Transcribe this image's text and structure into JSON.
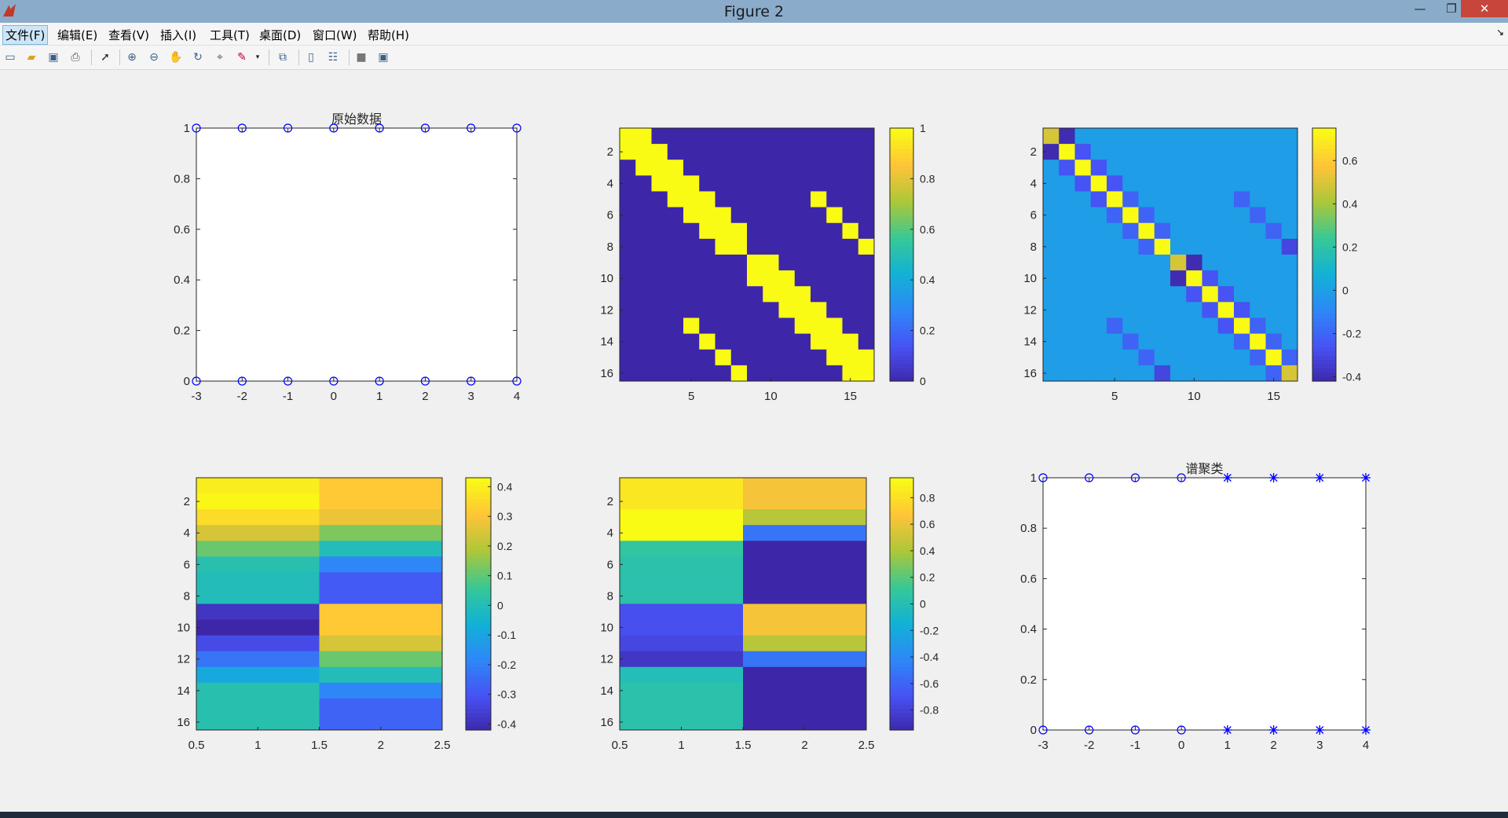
{
  "window": {
    "title": "Figure 2",
    "minimize": "—",
    "maximize": "❐",
    "close": "✕"
  },
  "menu": [
    {
      "label": "文件(F)",
      "active": true
    },
    {
      "label": "编辑(E)"
    },
    {
      "label": "查看(V)"
    },
    {
      "label": "插入(I)"
    },
    {
      "label": "工具(T)"
    },
    {
      "label": "桌面(D)"
    },
    {
      "label": "窗口(W)"
    },
    {
      "label": "帮助(H)"
    }
  ],
  "menu_arrow": "↘",
  "toolbar": [
    "new-figure-icon",
    "open-icon",
    "save-icon",
    "print-icon",
    "select-arrow-icon",
    "zoom-in-icon",
    "zoom-out-icon",
    "pan-hand-icon",
    "rotate-3d-icon",
    "data-cursor-icon",
    "brush-icon",
    "link-plot-icon",
    "colorbar-icon",
    "legend-icon",
    "hide-plot-tools-icon",
    "show-plot-tools-icon"
  ],
  "chart_data": [
    {
      "type": "scatter",
      "title": "原始数据",
      "xlim": [
        -3,
        4
      ],
      "ylim": [
        0,
        1
      ],
      "xticks": [
        "-3",
        "-2",
        "-1",
        "0",
        "1",
        "2",
        "3",
        "4"
      ],
      "yticks": [
        "0",
        "0.2",
        "0.4",
        "0.6",
        "0.8",
        "1"
      ],
      "series": [
        {
          "marker": "o",
          "color": "#0000ff",
          "x": [
            -3,
            -2,
            -1,
            0,
            1,
            2,
            3,
            4,
            -3,
            -2,
            -1,
            0,
            1,
            2,
            3,
            4
          ],
          "y": [
            1,
            1,
            1,
            1,
            1,
            1,
            1,
            1,
            0,
            0,
            0,
            0,
            0,
            0,
            0,
            0
          ]
        }
      ]
    },
    {
      "type": "heatmap",
      "rows": 16,
      "cols": 16,
      "xticks": [
        "5",
        "10",
        "15"
      ],
      "yticks": [
        "2",
        "4",
        "6",
        "8",
        "10",
        "12",
        "14",
        "16"
      ],
      "colorbar_ticks": [
        "0",
        "0.2",
        "0.4",
        "0.6",
        "0.8",
        "1"
      ],
      "clim": [
        0,
        1
      ],
      "pattern": "adjacency",
      "values": [
        [
          1,
          1,
          0,
          0,
          0,
          0,
          0,
          0,
          0,
          0,
          0,
          0,
          0,
          0,
          0,
          0
        ],
        [
          1,
          1,
          1,
          0,
          0,
          0,
          0,
          0,
          0,
          0,
          0,
          0,
          0,
          0,
          0,
          0
        ],
        [
          0,
          1,
          1,
          1,
          0,
          0,
          0,
          0,
          0,
          0,
          0,
          0,
          0,
          0,
          0,
          0
        ],
        [
          0,
          0,
          1,
          1,
          1,
          0,
          0,
          0,
          0,
          0,
          0,
          0,
          0,
          0,
          0,
          0
        ],
        [
          0,
          0,
          0,
          1,
          1,
          1,
          0,
          0,
          0,
          0,
          0,
          0,
          1,
          0,
          0,
          0
        ],
        [
          0,
          0,
          0,
          0,
          1,
          1,
          1,
          0,
          0,
          0,
          0,
          0,
          0,
          1,
          0,
          0
        ],
        [
          0,
          0,
          0,
          0,
          0,
          1,
          1,
          1,
          0,
          0,
          0,
          0,
          0,
          0,
          1,
          0
        ],
        [
          0,
          0,
          0,
          0,
          0,
          0,
          1,
          1,
          0,
          0,
          0,
          0,
          0,
          0,
          0,
          1
        ],
        [
          0,
          0,
          0,
          0,
          0,
          0,
          0,
          0,
          1,
          1,
          0,
          0,
          0,
          0,
          0,
          0
        ],
        [
          0,
          0,
          0,
          0,
          0,
          0,
          0,
          0,
          1,
          1,
          1,
          0,
          0,
          0,
          0,
          0
        ],
        [
          0,
          0,
          0,
          0,
          0,
          0,
          0,
          0,
          0,
          1,
          1,
          1,
          0,
          0,
          0,
          0
        ],
        [
          0,
          0,
          0,
          0,
          0,
          0,
          0,
          0,
          0,
          0,
          1,
          1,
          1,
          0,
          0,
          0
        ],
        [
          0,
          0,
          0,
          0,
          1,
          0,
          0,
          0,
          0,
          0,
          0,
          1,
          1,
          1,
          0,
          0
        ],
        [
          0,
          0,
          0,
          0,
          0,
          1,
          0,
          0,
          0,
          0,
          0,
          0,
          1,
          1,
          1,
          0
        ],
        [
          0,
          0,
          0,
          0,
          0,
          0,
          1,
          0,
          0,
          0,
          0,
          0,
          0,
          1,
          1,
          1
        ],
        [
          0,
          0,
          0,
          0,
          0,
          0,
          0,
          1,
          0,
          0,
          0,
          0,
          0,
          0,
          1,
          1
        ]
      ]
    },
    {
      "type": "heatmap",
      "rows": 16,
      "cols": 16,
      "xticks": [
        "5",
        "10",
        "15"
      ],
      "yticks": [
        "2",
        "4",
        "6",
        "8",
        "10",
        "12",
        "14",
        "16"
      ],
      "colorbar_ticks": [
        "-0.4",
        "-0.2",
        "0",
        "0.2",
        "0.4",
        "0.6"
      ],
      "clim": [
        -0.42,
        0.75
      ],
      "values": [
        [
          0.5,
          -0.4,
          0,
          0,
          0,
          0,
          0,
          0,
          0,
          0,
          0,
          0,
          0,
          0,
          0,
          0
        ],
        [
          -0.4,
          0.75,
          -0.25,
          0,
          0,
          0,
          0,
          0,
          0,
          0,
          0,
          0,
          0,
          0,
          0,
          0
        ],
        [
          0,
          -0.25,
          0.75,
          -0.25,
          0,
          0,
          0,
          0,
          0,
          0,
          0,
          0,
          0,
          0,
          0,
          0
        ],
        [
          0,
          0,
          -0.25,
          0.75,
          -0.25,
          0,
          0,
          0,
          0,
          0,
          0,
          0,
          0,
          0,
          0,
          0
        ],
        [
          0,
          0,
          0,
          -0.25,
          0.75,
          -0.2,
          0,
          0,
          0,
          0,
          0,
          0,
          -0.2,
          0,
          0,
          0
        ],
        [
          0,
          0,
          0,
          0,
          -0.2,
          0.75,
          -0.2,
          0,
          0,
          0,
          0,
          0,
          0,
          -0.2,
          0,
          0
        ],
        [
          0,
          0,
          0,
          0,
          0,
          -0.2,
          0.75,
          -0.2,
          0,
          0,
          0,
          0,
          0,
          0,
          -0.2,
          0
        ],
        [
          0,
          0,
          0,
          0,
          0,
          0,
          -0.2,
          0.75,
          0,
          0,
          0,
          0,
          0,
          0,
          0,
          -0.3
        ],
        [
          0,
          0,
          0,
          0,
          0,
          0,
          0,
          0,
          0.5,
          -0.4,
          0,
          0,
          0,
          0,
          0,
          0
        ],
        [
          0,
          0,
          0,
          0,
          0,
          0,
          0,
          0,
          -0.4,
          0.75,
          -0.25,
          0,
          0,
          0,
          0,
          0
        ],
        [
          0,
          0,
          0,
          0,
          0,
          0,
          0,
          0,
          0,
          -0.25,
          0.75,
          -0.25,
          0,
          0,
          0,
          0
        ],
        [
          0,
          0,
          0,
          0,
          0,
          0,
          0,
          0,
          0,
          0,
          -0.25,
          0.75,
          -0.25,
          0,
          0,
          0
        ],
        [
          0,
          0,
          0,
          0,
          -0.2,
          0,
          0,
          0,
          0,
          0,
          0,
          -0.25,
          0.75,
          -0.2,
          0,
          0
        ],
        [
          0,
          0,
          0,
          0,
          0,
          -0.2,
          0,
          0,
          0,
          0,
          0,
          0,
          -0.2,
          0.75,
          -0.2,
          0
        ],
        [
          0,
          0,
          0,
          0,
          0,
          0,
          -0.2,
          0,
          0,
          0,
          0,
          0,
          0,
          -0.2,
          0.75,
          -0.2
        ],
        [
          0,
          0,
          0,
          0,
          0,
          0,
          0,
          -0.3,
          0,
          0,
          0,
          0,
          0,
          0,
          -0.2,
          0.5
        ]
      ]
    },
    {
      "type": "heatmap",
      "rows": 16,
      "cols": 2,
      "xticks": [
        "0.5",
        "1",
        "1.5",
        "2",
        "2.5"
      ],
      "yticks": [
        "2",
        "4",
        "6",
        "8",
        "10",
        "12",
        "14",
        "16"
      ],
      "colorbar_ticks": [
        "-0.4",
        "-0.3",
        "-0.2",
        "-0.1",
        "0",
        "0.1",
        "0.2",
        "0.3",
        "0.4"
      ],
      "clim": [
        -0.42,
        0.43
      ],
      "values": [
        [
          0.4,
          0.32
        ],
        [
          0.42,
          0.32
        ],
        [
          0.36,
          0.28
        ],
        [
          0.25,
          0.14
        ],
        [
          0.12,
          0.0
        ],
        [
          0.02,
          -0.18
        ],
        [
          0.0,
          -0.28
        ],
        [
          0.0,
          -0.28
        ],
        [
          -0.38,
          0.32
        ],
        [
          -0.42,
          0.32
        ],
        [
          -0.32,
          0.25
        ],
        [
          -0.22,
          0.12
        ],
        [
          -0.08,
          0.0
        ],
        [
          0.02,
          -0.18
        ],
        [
          0.02,
          -0.26
        ],
        [
          0.02,
          -0.26
        ]
      ]
    },
    {
      "type": "heatmap",
      "rows": 16,
      "cols": 2,
      "xticks": [
        "0.5",
        "1",
        "1.5",
        "2",
        "2.5"
      ],
      "yticks": [
        "2",
        "4",
        "6",
        "8",
        "10",
        "12",
        "14",
        "16"
      ],
      "colorbar_ticks": [
        "-0.8",
        "-0.6",
        "-0.4",
        "-0.2",
        "0",
        "0.2",
        "0.4",
        "0.6",
        "0.8"
      ],
      "clim": [
        -0.95,
        0.95
      ],
      "values": [
        [
          0.85,
          0.65
        ],
        [
          0.85,
          0.65
        ],
        [
          0.95,
          0.45
        ],
        [
          0.95,
          -0.5
        ],
        [
          0.1,
          -0.95
        ],
        [
          0.05,
          -0.95
        ],
        [
          0.05,
          -0.95
        ],
        [
          0.05,
          -0.95
        ],
        [
          -0.7,
          0.65
        ],
        [
          -0.7,
          0.65
        ],
        [
          -0.75,
          0.45
        ],
        [
          -0.85,
          -0.5
        ],
        [
          0.0,
          -0.95
        ],
        [
          0.05,
          -0.95
        ],
        [
          0.05,
          -0.95
        ],
        [
          0.05,
          -0.95
        ]
      ]
    },
    {
      "type": "scatter",
      "title": "谱聚类",
      "xlim": [
        -3,
        4
      ],
      "ylim": [
        0,
        1
      ],
      "xticks": [
        "-3",
        "-2",
        "-1",
        "0",
        "1",
        "2",
        "3",
        "4"
      ],
      "yticks": [
        "0",
        "0.2",
        "0.4",
        "0.6",
        "0.8",
        "1"
      ],
      "series": [
        {
          "marker": "o",
          "color": "#0000ff",
          "x": [
            -3,
            -2,
            -1,
            0,
            -3,
            -2,
            -1,
            0
          ],
          "y": [
            1,
            1,
            1,
            1,
            0,
            0,
            0,
            0
          ]
        },
        {
          "marker": "*",
          "color": "#0000ff",
          "x": [
            1,
            2,
            3,
            4,
            1,
            2,
            3,
            4
          ],
          "y": [
            1,
            1,
            1,
            1,
            0,
            0,
            0,
            0
          ]
        }
      ]
    }
  ]
}
